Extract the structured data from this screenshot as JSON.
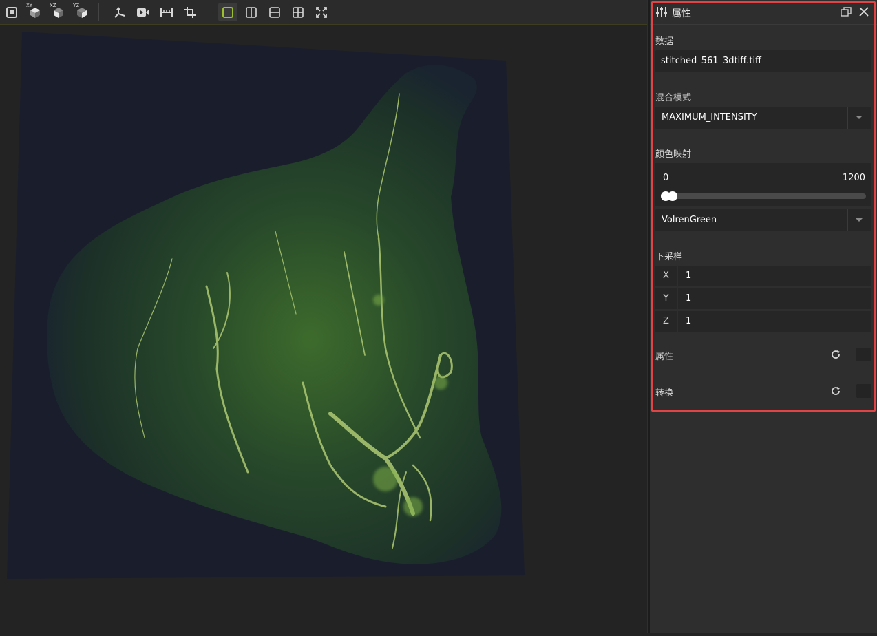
{
  "toolbar": {
    "icons": [
      "viewport-toggle-icon",
      "view-xy-icon",
      "view-xz-icon",
      "view-yz-icon",
      "axes-icon",
      "video-icon",
      "ruler-icon",
      "crop-icon",
      "layout-single-icon",
      "layout-two-vertical-icon",
      "layout-two-horizontal-icon",
      "layout-quad-icon",
      "fit-screen-icon"
    ],
    "cube_labels": {
      "xy": "XY",
      "xz": "XZ",
      "yz": "YZ"
    },
    "accent_color": "#9bbf2f"
  },
  "panel": {
    "title": "属性",
    "data_label": "数据",
    "data_value": "stitched_561_3dtiff.tiff",
    "blend_label": "混合模式",
    "blend_value": "MAXIMUM_INTENSITY",
    "colormap_label": "颜色映射",
    "colormap_min": "0",
    "colormap_max": "1200",
    "colormap_range_fraction": [
      0.0,
      0.01
    ],
    "colormap_value": "VolrenGreen",
    "downsample_label": "下采样",
    "downsample": [
      {
        "axis": "X",
        "value": "1"
      },
      {
        "axis": "Y",
        "value": "1"
      },
      {
        "axis": "Z",
        "value": "1"
      }
    ],
    "properties_row_label": "属性",
    "transform_row_label": "转换",
    "highlight_color": "#e04444"
  },
  "viewport": {
    "image_colormap": "VolrenGreen",
    "background_color": "#1a1e2c"
  }
}
